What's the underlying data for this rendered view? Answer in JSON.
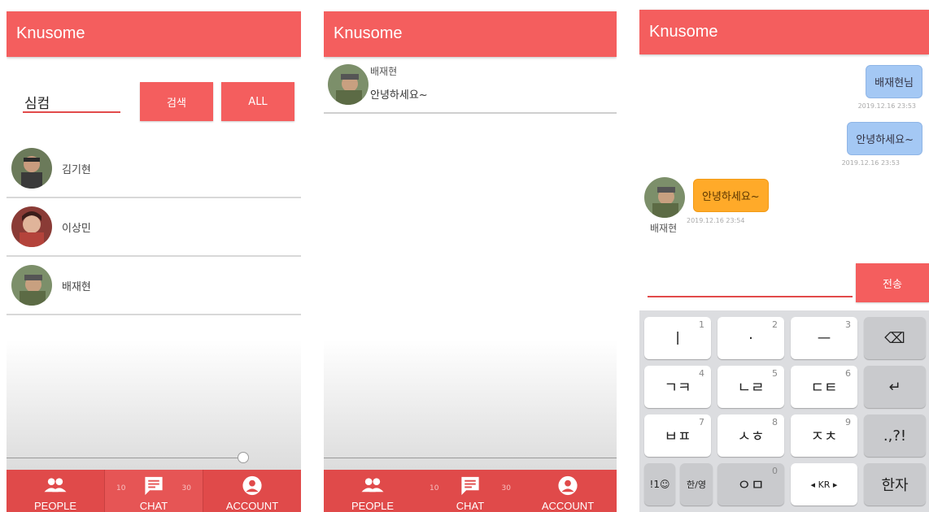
{
  "app_title": "Knusome",
  "search": {
    "value": "심컴",
    "search_label": "검색",
    "all_label": "ALL"
  },
  "people": [
    {
      "name": "김기현"
    },
    {
      "name": "이상민"
    },
    {
      "name": "배재현"
    }
  ],
  "nav": {
    "people": "PEOPLE",
    "chat": "CHAT",
    "account": "ACCOUNT",
    "back10": "10",
    "fwd30": "30"
  },
  "chat_room": {
    "name": "배재현",
    "last_message": "안녕하세요~"
  },
  "messages": [
    {
      "dir": "out",
      "text": "배재현님",
      "time": "2019.12.16 23:53"
    },
    {
      "dir": "out",
      "text": "안녕하세요~",
      "time": "2019.12.16 23:53"
    },
    {
      "dir": "in",
      "sender": "배재현",
      "text": "안녕하세요~",
      "time": "2019.12.16 23:54"
    }
  ],
  "send_label": "전송",
  "keyboard": {
    "rows": [
      [
        {
          "label": "ㅣ",
          "num": "1"
        },
        {
          "label": "·",
          "num": "2"
        },
        {
          "label": "ㅡ",
          "num": "3"
        },
        {
          "label": "⌫"
        }
      ],
      [
        {
          "label": "ㄱㅋ",
          "num": "4"
        },
        {
          "label": "ㄴㄹ",
          "num": "5"
        },
        {
          "label": "ㄷㅌ",
          "num": "6"
        },
        {
          "label": "↵"
        }
      ],
      [
        {
          "label": "ㅂㅍ",
          "num": "7"
        },
        {
          "label": "ㅅㅎ",
          "num": "8"
        },
        {
          "label": "ㅈㅊ",
          "num": "9"
        },
        {
          "label": ".,?!"
        }
      ],
      [
        {
          "label": "!1☺"
        },
        {
          "label": "한/영"
        },
        {
          "label": "ㅇㅁ",
          "num": "0"
        },
        {
          "label": "◂ KR ▸"
        },
        {
          "label": "한자"
        }
      ]
    ]
  },
  "colors": {
    "primary": "#f45e5e",
    "nav": "#e04a4a",
    "bubble_out": "#a4c8f4",
    "bubble_in": "#ffaa29"
  }
}
